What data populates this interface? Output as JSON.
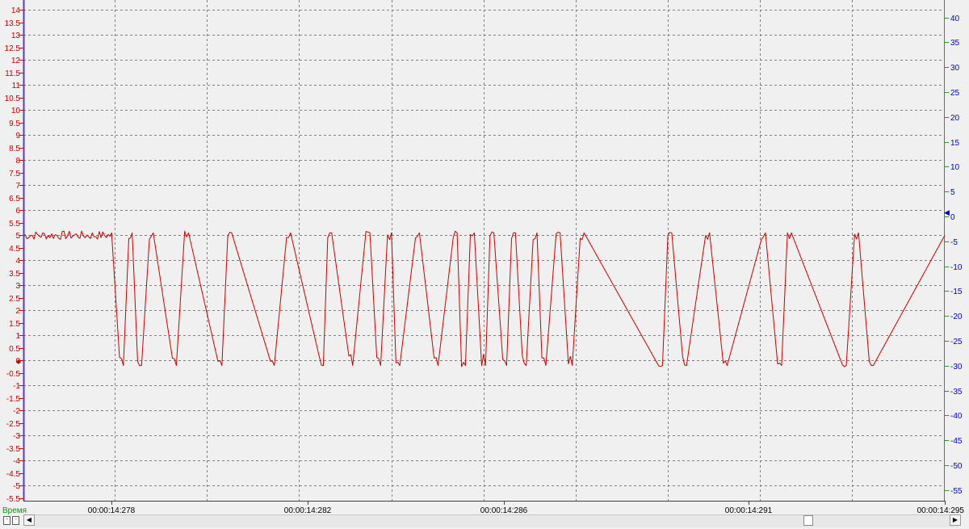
{
  "chart_data": {
    "type": "line",
    "left_axis": {
      "ticks": [
        "14",
        "13.5",
        "13",
        "12.5",
        "12",
        "11.5",
        "11",
        "10.5",
        "10",
        "9.5",
        "9",
        "8.5",
        "8",
        "7.5",
        "7",
        "6.5",
        "6",
        "5.5",
        "5",
        "4.5",
        "4",
        "3.5",
        "3",
        "2.5",
        "2",
        "1.5",
        "1",
        "0.5",
        "0",
        "-0.5",
        "-1",
        "-1.5",
        "-2",
        "-2.5",
        "-3",
        "-3.5",
        "-4",
        "-4.5",
        "-5",
        "-5.5"
      ],
      "range": [
        -5.5,
        14
      ],
      "color": "#cc0000"
    },
    "right_axis": {
      "ticks": [
        "40",
        "35",
        "30",
        "25",
        "20",
        "15",
        "10",
        "5",
        "0",
        "-5",
        "-10",
        "-15",
        "-20",
        "-25",
        "-30",
        "-35",
        "-40",
        "-45",
        "-50",
        "-55"
      ],
      "range": [
        -55,
        40
      ],
      "color": "#0000cc"
    },
    "x_axis": {
      "label": "Время",
      "tick_labels": [
        "00:00:14:278",
        "00:00:14:282",
        "00:00:14:286",
        "00:00:14:291",
        "00:00:14:295"
      ],
      "tick_time_ms": [
        278,
        282,
        286,
        291,
        295
      ],
      "range_ms": [
        276.2,
        295
      ]
    },
    "grid": true,
    "series": [
      {
        "color": "#cc0000",
        "high_level": 5.0,
        "low_level": 0.0,
        "x_ms": [
          276.2,
          278.0,
          278.16,
          278.24,
          278.35,
          278.42,
          278.53,
          278.61,
          278.77,
          278.85,
          279.24,
          279.32,
          279.49,
          279.57,
          280.17,
          280.25,
          280.37,
          280.45,
          281.24,
          281.32,
          281.57,
          281.65,
          282.24,
          282.32,
          282.41,
          282.49,
          282.84,
          282.92,
          283.19,
          283.27,
          283.41,
          283.49,
          283.63,
          283.71,
          283.8,
          283.88,
          284.2,
          284.28,
          284.58,
          284.66,
          284.97,
          285.05,
          285.14,
          285.22,
          285.32,
          285.4,
          285.55,
          285.63,
          285.72,
          285.8,
          285.98,
          286.06,
          286.16,
          286.24,
          286.38,
          286.46,
          286.6,
          286.68,
          286.78,
          286.86,
          287.07,
          287.15,
          287.32,
          287.4,
          287.56,
          287.64,
          289.16,
          289.24,
          289.35,
          289.43,
          289.65,
          289.73,
          290.12,
          290.2,
          290.48,
          290.56,
          291.26,
          291.34,
          291.59,
          291.67,
          291.79,
          291.87,
          292.91,
          292.99,
          293.16,
          293.24,
          293.46,
          293.54,
          295.0
        ],
        "values": [
          5,
          5,
          0,
          0,
          5,
          5,
          0,
          0,
          5,
          5,
          0,
          0,
          5,
          5,
          0,
          0,
          5,
          5,
          0,
          0,
          5,
          5,
          0,
          0,
          5,
          5,
          0,
          0,
          5,
          5,
          0,
          0,
          5,
          5,
          0,
          0,
          5,
          5,
          0,
          0,
          5,
          5,
          0,
          0,
          5,
          5,
          0,
          0,
          5,
          5,
          0,
          0,
          5,
          5,
          0,
          0,
          5,
          5,
          0,
          0,
          5,
          5,
          0,
          0,
          5,
          5,
          0,
          0,
          5,
          5,
          0,
          0,
          5,
          5,
          0,
          0,
          5,
          5,
          0,
          0,
          5,
          5,
          0,
          0,
          5,
          5,
          0,
          0,
          5
        ]
      }
    ]
  },
  "markers": {
    "left_zero": "◆",
    "right_zero": "◀"
  },
  "scroll": {
    "left_arrow": "◀",
    "right_arrow": "▶",
    "btn_a": "-",
    "btn_b": "-"
  }
}
